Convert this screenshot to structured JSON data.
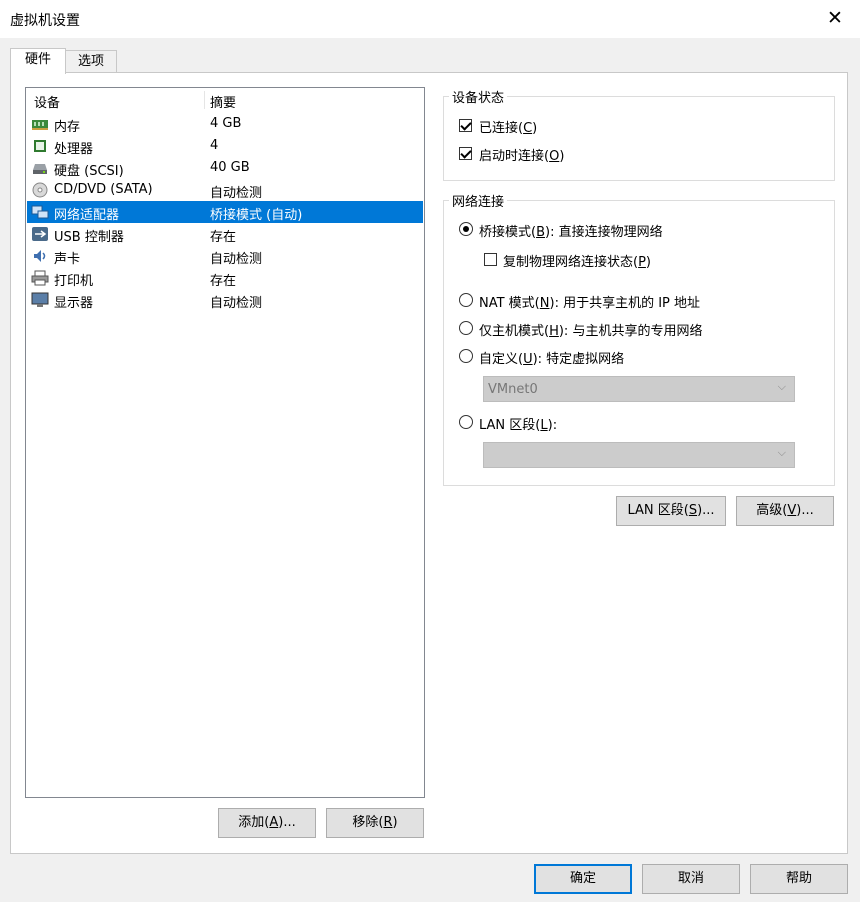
{
  "window": {
    "title": "虚拟机设置"
  },
  "tabs": [
    {
      "label": "硬件"
    },
    {
      "label": "选项"
    }
  ],
  "device_list": {
    "columns": [
      "设备",
      "摘要"
    ],
    "rows": [
      {
        "name": "内存",
        "summary": "4 GB",
        "icon": "memory-icon"
      },
      {
        "name": "处理器",
        "summary": "4",
        "icon": "processor-icon"
      },
      {
        "name": "硬盘 (SCSI)",
        "summary": "40 GB",
        "icon": "hard-disk-icon"
      },
      {
        "name": "CD/DVD (SATA)",
        "summary": "自动检测",
        "icon": "cd-dvd-icon"
      },
      {
        "name": "网络适配器",
        "summary": "桥接模式 (自动)",
        "icon": "network-adapter-icon",
        "selected": true
      },
      {
        "name": "USB 控制器",
        "summary": "存在",
        "icon": "usb-icon"
      },
      {
        "name": "声卡",
        "summary": "自动检测",
        "icon": "sound-card-icon"
      },
      {
        "name": "打印机",
        "summary": "存在",
        "icon": "printer-icon"
      },
      {
        "name": "显示器",
        "summary": "自动检测",
        "icon": "display-icon"
      }
    ]
  },
  "list_buttons": {
    "add": {
      "text": "添加(",
      "key": "A",
      "tail": ")..."
    },
    "remove": {
      "text": "移除(",
      "key": "R",
      "tail": ")"
    }
  },
  "device_status": {
    "title": "设备状态",
    "connected": {
      "text": "已连接(",
      "key": "C",
      "tail": ")",
      "checked": true
    },
    "connect_on_power": {
      "text": "启动时连接(",
      "key": "O",
      "tail": ")",
      "checked": true
    }
  },
  "network": {
    "title": "网络连接",
    "bridged": {
      "text": "桥接模式(",
      "key": "B",
      "tail": "): 直接连接物理网络",
      "selected": true
    },
    "replicate": {
      "text": "复制物理网络连接状态(",
      "key": "P",
      "tail": ")",
      "checked": false
    },
    "nat": {
      "text": "NAT 模式(",
      "key": "N",
      "tail": "): 用于共享主机的 IP 地址"
    },
    "host_only": {
      "text": "仅主机模式(",
      "key": "H",
      "tail": "): 与主机共享的专用网络"
    },
    "custom": {
      "text": "自定义(",
      "key": "U",
      "tail": "): 特定虚拟网络"
    },
    "custom_value": "VMnet0",
    "lan": {
      "text": "LAN 区段(",
      "key": "L",
      "tail": "):"
    },
    "lan_value": ""
  },
  "side_buttons": {
    "lan_segments": {
      "text": "LAN 区段(",
      "key": "S",
      "tail": ")..."
    },
    "advanced": {
      "text": "高级(",
      "key": "V",
      "tail": ")..."
    }
  },
  "footer": {
    "ok": "确定",
    "cancel": "取消",
    "help": "帮助"
  },
  "colors": {
    "selection": "#0078d7",
    "background": "#f0f0f0"
  }
}
